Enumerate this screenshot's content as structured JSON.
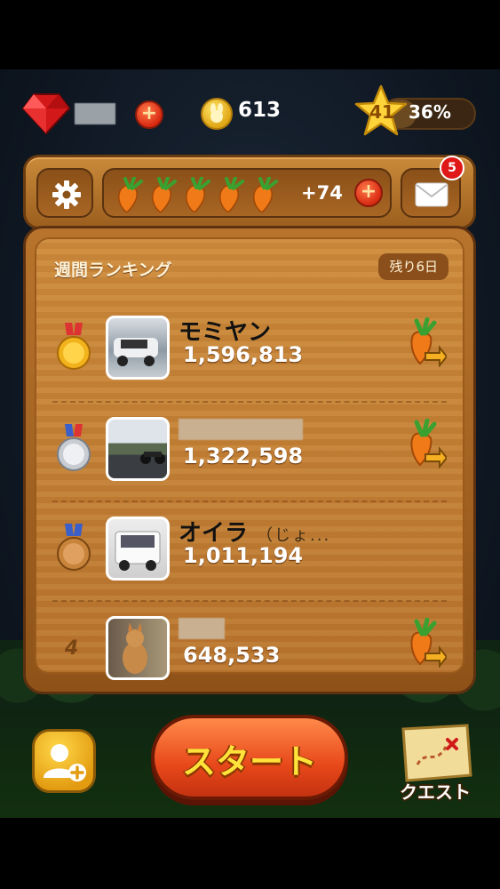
{
  "top_bar": {
    "gem_icon": "red-gem-icon",
    "coin_count": "613",
    "level": "41",
    "level_progress": "36%",
    "level_progress_value": 0.36
  },
  "header": {
    "carrot_count": 5,
    "carrot_bonus": "+74",
    "mail_badge": "5"
  },
  "ranking": {
    "title": "週間ランキング",
    "remaining": "残り6日",
    "rows": [
      {
        "rank": "1",
        "name": "モミヤン",
        "name_suffix": "",
        "score": "1,596,813"
      },
      {
        "rank": "2",
        "name": "",
        "name_suffix": "",
        "score": "1,322,598"
      },
      {
        "rank": "3",
        "name": "オイラ",
        "name_suffix": "（じょ...",
        "score": "1,011,194"
      },
      {
        "rank": "4",
        "name": "",
        "name_suffix": "",
        "score": "648,533"
      }
    ]
  },
  "buttons": {
    "start": "スタート",
    "quest": "クエスト"
  },
  "colors": {
    "wood": "#b8742c",
    "start": "#e8481a",
    "accent_yellow": "#ffe23a"
  }
}
